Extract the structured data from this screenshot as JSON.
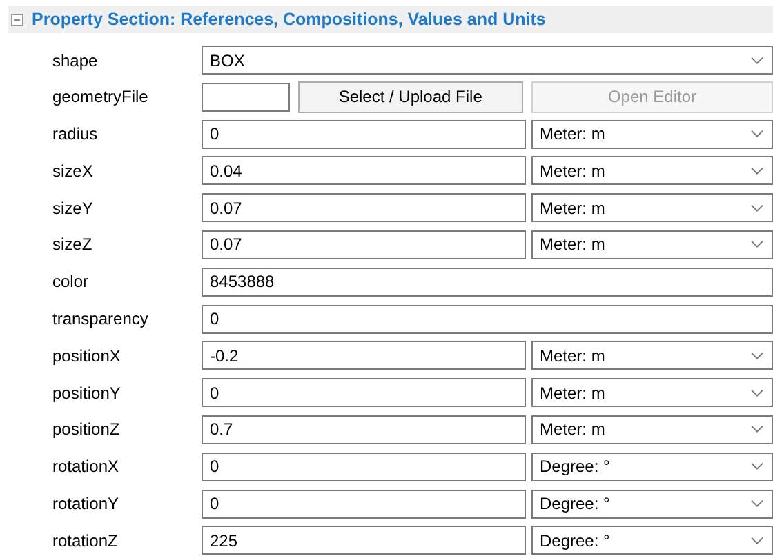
{
  "section": {
    "title": "Property Section: References, Compositions, Values and Units",
    "expanded": true
  },
  "rows": [
    {
      "kind": "select",
      "label": "shape",
      "value": "BOX"
    },
    {
      "kind": "file",
      "label": "geometryFile",
      "upload_button": "Select / Upload File",
      "editor_button": "Open Editor",
      "editor_disabled": true
    },
    {
      "kind": "quantity",
      "label": "radius",
      "value": "0",
      "unit": "Meter: m"
    },
    {
      "kind": "quantity",
      "label": "sizeX",
      "value": "0.04",
      "unit": "Meter: m"
    },
    {
      "kind": "quantity",
      "label": "sizeY",
      "value": "0.07",
      "unit": "Meter: m"
    },
    {
      "kind": "quantity",
      "label": "sizeZ",
      "value": "0.07",
      "unit": "Meter: m"
    },
    {
      "kind": "text",
      "label": "color",
      "value": "8453888"
    },
    {
      "kind": "text",
      "label": "transparency",
      "value": "0"
    },
    {
      "kind": "quantity",
      "label": "positionX",
      "value": "-0.2",
      "unit": "Meter: m"
    },
    {
      "kind": "quantity",
      "label": "positionY",
      "value": "0",
      "unit": "Meter: m"
    },
    {
      "kind": "quantity",
      "label": "positionZ",
      "value": "0.7",
      "unit": "Meter: m"
    },
    {
      "kind": "quantity",
      "label": "rotationX",
      "value": "0",
      "unit": "Degree: °"
    },
    {
      "kind": "quantity",
      "label": "rotationY",
      "value": "0",
      "unit": "Degree: °"
    },
    {
      "kind": "quantity",
      "label": "rotationZ",
      "value": "225",
      "unit": "Degree: °"
    }
  ]
}
